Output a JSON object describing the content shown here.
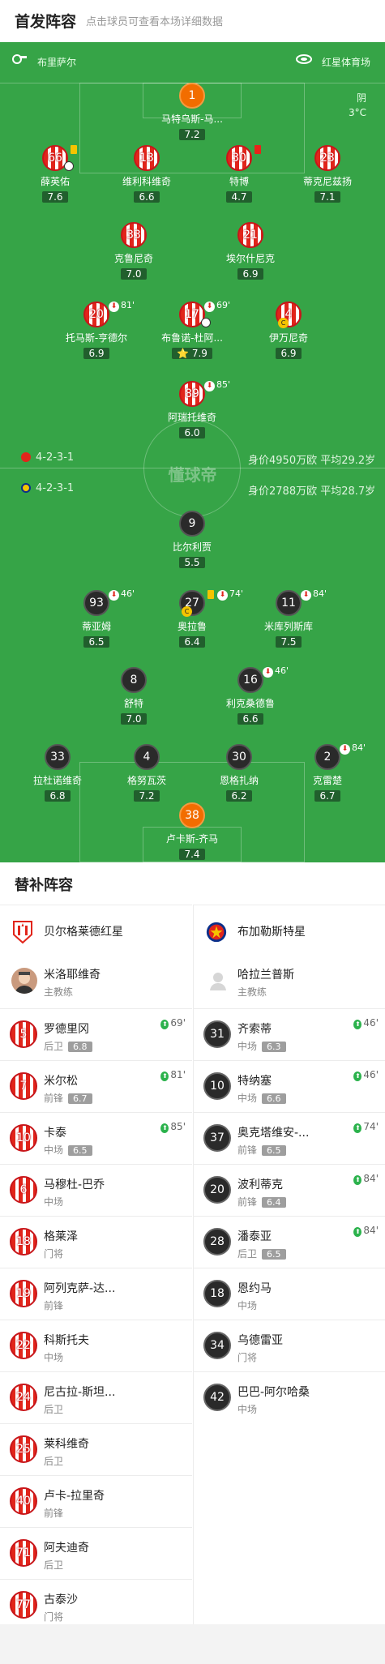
{
  "header": {
    "title": "首发阵容",
    "subtitle": "点击球员可查看本场详细数据"
  },
  "match": {
    "home_team": "布里萨尔",
    "venue": "红星体育场",
    "weather": "阴",
    "temp": "3°C",
    "watermark": "懂球帝",
    "home_formation": "4-2-3-1",
    "home_value": "身价4950万欧 平均29.2岁",
    "away_formation": "4-2-3-1",
    "away_value": "身价2788万欧 平均28.7岁"
  },
  "home_players": [
    {
      "no": "1",
      "name": "马特乌斯-马...",
      "rating": "7.2"
    },
    {
      "no": "66",
      "name": "薛英佑",
      "rating": "7.6"
    },
    {
      "no": "13",
      "name": "维利科维奇",
      "rating": "6.6"
    },
    {
      "no": "30",
      "name": "特博",
      "rating": "4.7"
    },
    {
      "no": "23",
      "name": "蒂克尼兹扬",
      "rating": "7.1"
    },
    {
      "no": "33",
      "name": "克鲁尼奇",
      "rating": "7.0"
    },
    {
      "no": "21",
      "name": "埃尔什尼克",
      "rating": "6.9"
    },
    {
      "no": "20",
      "name": "托马斯-亨德尔",
      "rating": "6.9",
      "sub": "81'"
    },
    {
      "no": "17",
      "name": "布鲁诺-杜阿...",
      "rating": "7.9",
      "sub": "69'"
    },
    {
      "no": "4",
      "name": "伊万尼奇",
      "rating": "6.9"
    },
    {
      "no": "89",
      "name": "阿瑞托维奇",
      "rating": "6.0",
      "sub": "85'"
    }
  ],
  "away_players": [
    {
      "no": "9",
      "name": "比尔利贾",
      "rating": "5.5"
    },
    {
      "no": "93",
      "name": "蒂亚姆",
      "rating": "6.5",
      "sub": "46'"
    },
    {
      "no": "27",
      "name": "奥拉鲁",
      "rating": "6.4",
      "sub": "74'"
    },
    {
      "no": "11",
      "name": "米库列斯库",
      "rating": "7.5",
      "sub": "84'"
    },
    {
      "no": "8",
      "name": "舒特",
      "rating": "7.0"
    },
    {
      "no": "16",
      "name": "利克桑德鲁",
      "rating": "6.6",
      "sub": "46'"
    },
    {
      "no": "33",
      "name": "拉杜诺维奇",
      "rating": "6.8"
    },
    {
      "no": "4",
      "name": "格努瓦茨",
      "rating": "7.2"
    },
    {
      "no": "30",
      "name": "恩格扎纳",
      "rating": "6.2"
    },
    {
      "no": "2",
      "name": "克雷楚",
      "rating": "6.7",
      "sub": "84'"
    },
    {
      "no": "38",
      "name": "卢卡斯-齐马",
      "rating": "7.4"
    }
  ],
  "subs": {
    "title": "替补阵容",
    "left_team": "贝尔格莱德红星",
    "right_team": "布加勒斯特星",
    "left_coach": {
      "name": "米洛耶维奇",
      "role": "主教练"
    },
    "right_coach": {
      "name": "哈拉兰普斯",
      "role": "主教练"
    },
    "left": [
      {
        "no": "5",
        "name": "罗德里冈",
        "pos": "后卫",
        "rating": "6.8",
        "min": "69'"
      },
      {
        "no": "7",
        "name": "米尔松",
        "pos": "前锋",
        "rating": "6.7",
        "min": "81'"
      },
      {
        "no": "10",
        "name": "卡泰",
        "pos": "中场",
        "rating": "6.5",
        "min": "85'"
      },
      {
        "no": "6",
        "name": "马穆杜-巴乔",
        "pos": "中场"
      },
      {
        "no": "18",
        "name": "格莱泽",
        "pos": "门将"
      },
      {
        "no": "19",
        "name": "阿列克萨-达...",
        "pos": "前锋"
      },
      {
        "no": "22",
        "name": "科斯托夫",
        "pos": "中场"
      },
      {
        "no": "24",
        "name": "尼古拉-斯坦...",
        "pos": "后卫"
      },
      {
        "no": "25",
        "name": "莱科维奇",
        "pos": "后卫"
      },
      {
        "no": "40",
        "name": "卢卡-拉里奇",
        "pos": "前锋"
      },
      {
        "no": "71",
        "name": "阿夫迪奇",
        "pos": "后卫"
      },
      {
        "no": "77",
        "name": "古泰沙",
        "pos": "门将"
      }
    ],
    "right": [
      {
        "no": "31",
        "name": "齐索蒂",
        "pos": "中场",
        "rating": "6.3",
        "min": "46'"
      },
      {
        "no": "10",
        "name": "特纳塞",
        "pos": "中场",
        "rating": "6.6",
        "min": "46'"
      },
      {
        "no": "37",
        "name": "奥克塔维安-...",
        "pos": "前锋",
        "rating": "6.5",
        "min": "74'"
      },
      {
        "no": "20",
        "name": "波利蒂克",
        "pos": "前锋",
        "rating": "6.4",
        "min": "84'"
      },
      {
        "no": "28",
        "name": "潘泰亚",
        "pos": "后卫",
        "rating": "6.5",
        "min": "84'"
      },
      {
        "no": "18",
        "name": "恩约马",
        "pos": "中场"
      },
      {
        "no": "34",
        "name": "乌德雷亚",
        "pos": "门将"
      },
      {
        "no": "42",
        "name": "巴巴-阿尔哈桑",
        "pos": "中场"
      }
    ]
  }
}
